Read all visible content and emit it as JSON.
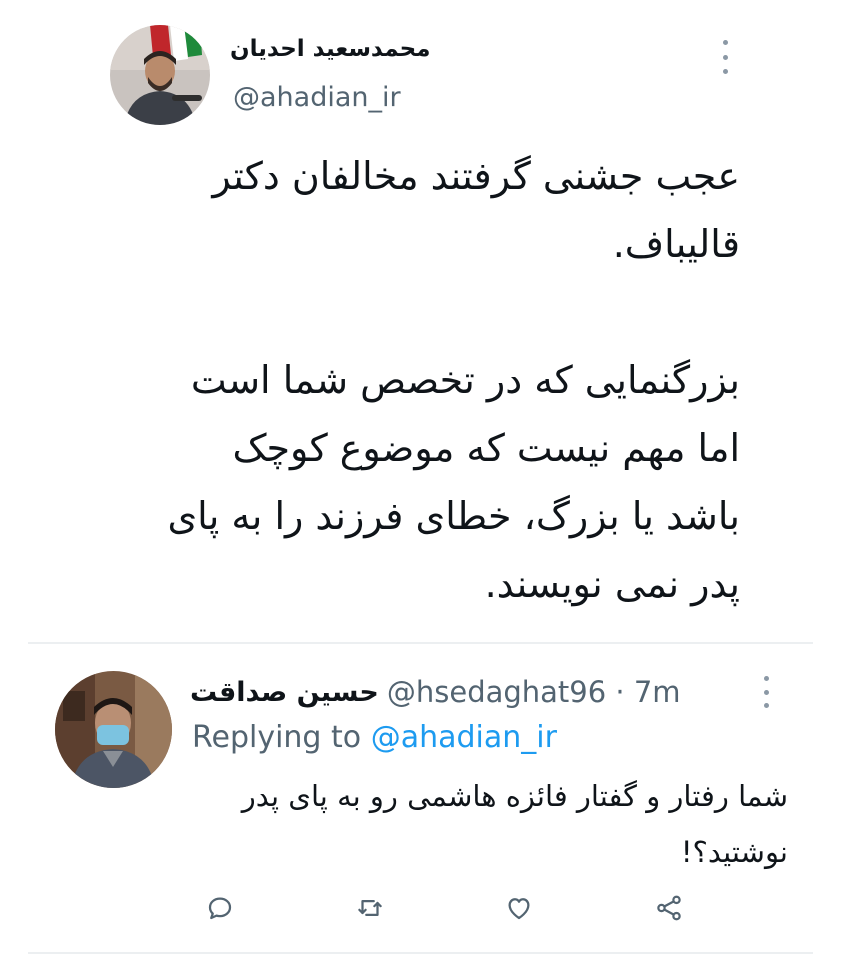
{
  "tweet": {
    "author_name": "محمدسعید احدیان",
    "author_handle": "@ahadian_ir",
    "paragraphs": [
      [
        "عجب جشنی گرفتند مخالفان دکتر",
        "قالیباف."
      ],
      [
        "بزرگنمایی که در تخصص شما است",
        "اما مهم نیست که موضوع کوچک",
        "باشد یا بزرگ، خطای فرزند را به پای",
        "پدر نمی نویسند."
      ]
    ]
  },
  "reply": {
    "author_name": "حسین صداقت",
    "handle_time": "@hsedaghat96 · 7m",
    "replying_label": "Replying to",
    "replying_to": "@ahadian_ir",
    "lines": [
      "شما رفتار و گفتار فائزه هاشمی رو به پای پدر",
      "نوشتید؟!"
    ]
  },
  "actions": [
    "reply-icon",
    "retweet-icon",
    "like-icon",
    "share-icon"
  ],
  "colors": {
    "link": "#1d9bf0",
    "muted": "#536471",
    "icon": "#536471"
  }
}
